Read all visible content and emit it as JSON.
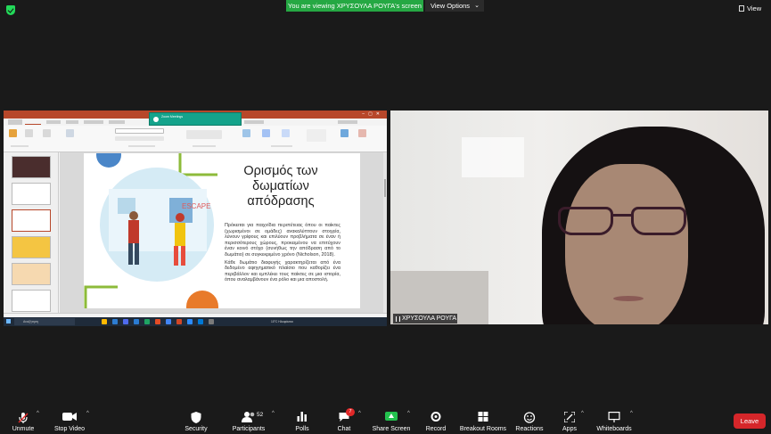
{
  "top": {
    "banner": "You are viewing ΧΡΥΣΟΥΛΑ ΡΟΥΓΑ's screen",
    "view_options": "View Options",
    "view": "View"
  },
  "shared": {
    "slide_title_lines": [
      "Ορισμός των",
      "δωματίων",
      "απόδρασης"
    ],
    "slide_body_1": "Πρόκειται για παιχνίδια περιπέτειας όπου οι παίκτες (χωρισμένοι σε ομάδες) ανακαλύπτουν στοιχεία, λύνουν γρίφους και επιλύουν προβλήματα σε έναν ή περισσότερους χώρους, προκειμένου να επιτύχουν έναν κοινό στόχο (συνήθως την απόδραση από το δωμάτιο) σε συγκεκριμένο χρόνο (Nicholson, 2018).",
    "slide_body_2": "Κάθε δωμάτιο διαφυγής χαρακτηρίζεται από ένα δεδομένο αφηγηματικό πλαίσιο που καθορίζει ένα περιβάλλον και εμπλέκει τους παίκτες σε μια ιστορία, όπου αναλαμβάνουν ένα ρόλο και μια αποστολή.",
    "image_text": "ESCAPE",
    "zoom_notification_title": "Zoom Meetings",
    "search_placeholder": "Αναζήτηση",
    "weather": "10°C Ηλιοφάνεια"
  },
  "participant": {
    "name": "ΧΡΥΣΟΥΛΑ ΡΟΥΓΑ"
  },
  "toolbar": {
    "unmute": "Unmute",
    "stop_video": "Stop Video",
    "security": "Security",
    "participants": "Participants",
    "participants_count": "52",
    "polls": "Polls",
    "chat": "Chat",
    "chat_badge": "7",
    "share_screen": "Share Screen",
    "record": "Record",
    "breakout_rooms": "Breakout Rooms",
    "reactions": "Reactions",
    "apps": "Apps",
    "whiteboards": "Whiteboards",
    "leave": "Leave"
  },
  "colors": {
    "banner_green": "#25a843",
    "leave_red": "#d5262a",
    "share_green": "#23c14e",
    "ppt_accent": "#b7472a"
  }
}
